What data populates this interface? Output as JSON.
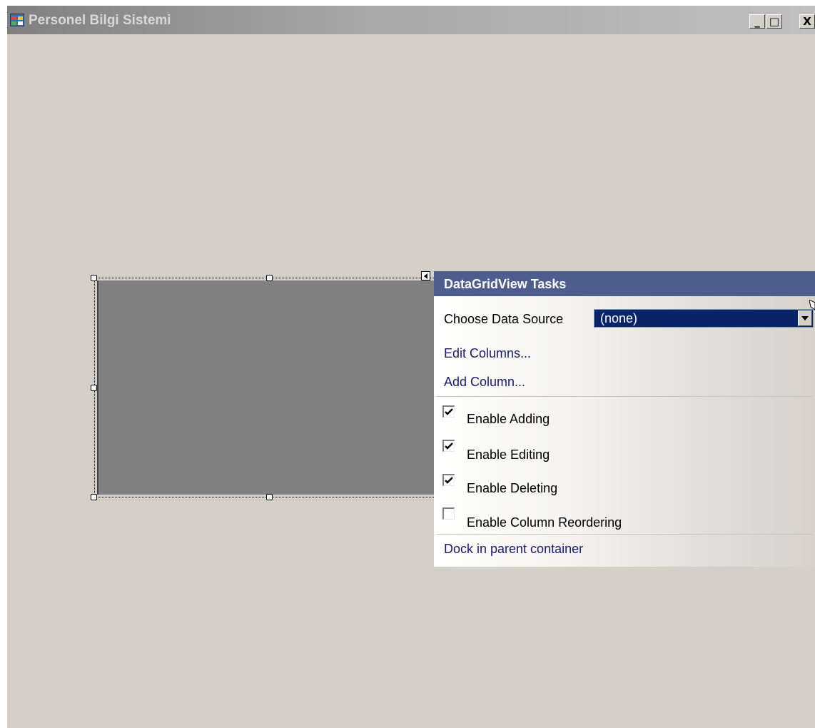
{
  "window": {
    "title": "Personel Bilgi Sistemi",
    "buttons": {
      "minimize": "_",
      "maximize": "□",
      "close": "X"
    }
  },
  "tasks_panel": {
    "title": "DataGridView Tasks",
    "data_source": {
      "label": "Choose Data Source",
      "selected": "(none)"
    },
    "links": {
      "edit_columns": "Edit Columns...",
      "add_column": "Add Column...",
      "dock": "Dock in parent container"
    },
    "options": [
      {
        "label": "Enable Adding",
        "checked": true
      },
      {
        "label": "Enable Editing",
        "checked": true
      },
      {
        "label": "Enable Deleting",
        "checked": true
      },
      {
        "label": "Enable Column Reordering",
        "checked": false
      }
    ]
  },
  "colors": {
    "form_background": "#d4d0c8",
    "grid_background": "#808080",
    "panel_header": "#4d5d8e",
    "combo_selected": "#0a246a",
    "link": "#1a1a6e"
  },
  "icons": {
    "app": "form-icon",
    "smart_tag": "smart-tag-arrow-icon",
    "combo": "dropdown-arrow-icon",
    "check": "checkmark-icon",
    "pointer": "mouse-pointer-icon"
  }
}
